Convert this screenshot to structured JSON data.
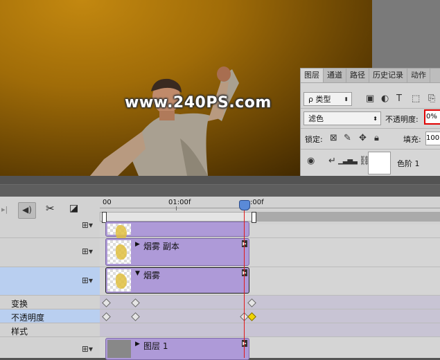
{
  "canvas": {
    "watermark": "www.240PS.com"
  },
  "layers_panel": {
    "tabs": [
      "图层",
      "通道",
      "路径",
      "历史记录",
      "动作"
    ],
    "filter": {
      "label": "ρ 类型"
    },
    "blend_mode": "滤色",
    "opacity_label": "不透明度:",
    "opacity_value": "0%",
    "lock_label": "锁定:",
    "fill_label": "填充:",
    "fill_value": "100",
    "layer": {
      "name": "色阶 1"
    }
  },
  "timeline": {
    "ruler": {
      "t0": "00",
      "t1": "01:00f",
      "t2": ":00f"
    },
    "rows": {
      "clip_top": "",
      "clip_copy": "烟雾 副本",
      "clip_smoke": "烟雾",
      "prop_transform": "变换",
      "prop_opacity": "不透明度",
      "prop_style": "样式",
      "clip_layer1": "图层 1"
    }
  }
}
